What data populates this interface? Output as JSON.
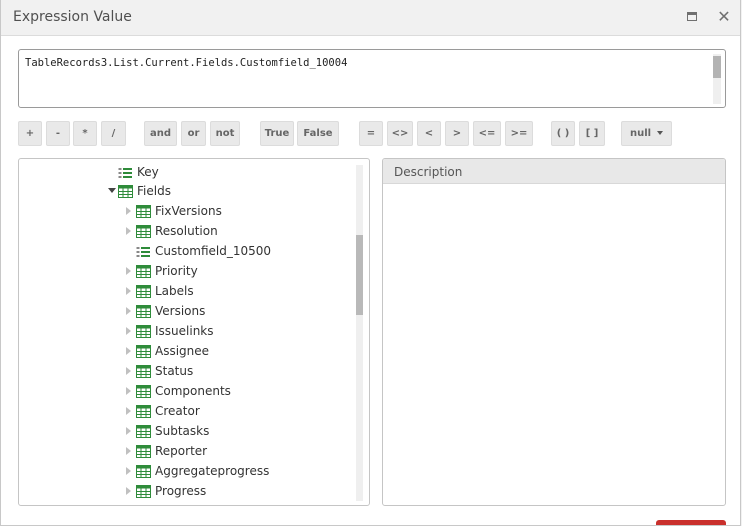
{
  "dialog": {
    "title": "Expression Value"
  },
  "expression": {
    "value": "TableRecords3.List.Current.Fields.Customfield_10004"
  },
  "operators": {
    "plus": "+",
    "minus": "-",
    "multiply": "*",
    "divide": "/",
    "and": "and",
    "or": "or",
    "not": "not",
    "true": "True",
    "false": "False",
    "eq": "=",
    "neq": "<>",
    "lt": "<",
    "gt": ">",
    "lte": "<=",
    "gte": ">=",
    "parens": "( )",
    "brackets": "[ ]",
    "null": "null"
  },
  "tree": {
    "key_label": "Key",
    "fields_label": "Fields",
    "items": [
      {
        "label": "FixVersions",
        "icon": "table-icon"
      },
      {
        "label": "Resolution",
        "icon": "table-icon"
      },
      {
        "label": "Customfield_10500",
        "icon": "field-icon"
      },
      {
        "label": "Priority",
        "icon": "table-icon"
      },
      {
        "label": "Labels",
        "icon": "table-icon"
      },
      {
        "label": "Versions",
        "icon": "table-icon"
      },
      {
        "label": "Issuelinks",
        "icon": "table-icon"
      },
      {
        "label": "Assignee",
        "icon": "table-icon"
      },
      {
        "label": "Status",
        "icon": "table-icon"
      },
      {
        "label": "Components",
        "icon": "table-icon"
      },
      {
        "label": "Creator",
        "icon": "table-icon"
      },
      {
        "label": "Subtasks",
        "icon": "table-icon"
      },
      {
        "label": "Reporter",
        "icon": "table-icon"
      },
      {
        "label": "Aggregateprogress",
        "icon": "table-icon"
      },
      {
        "label": "Progress",
        "icon": "table-icon"
      }
    ]
  },
  "description": {
    "header": "Description",
    "text": ""
  },
  "colors": {
    "icon_green": "#2e8b3a",
    "ok_button": "#c9302c"
  }
}
